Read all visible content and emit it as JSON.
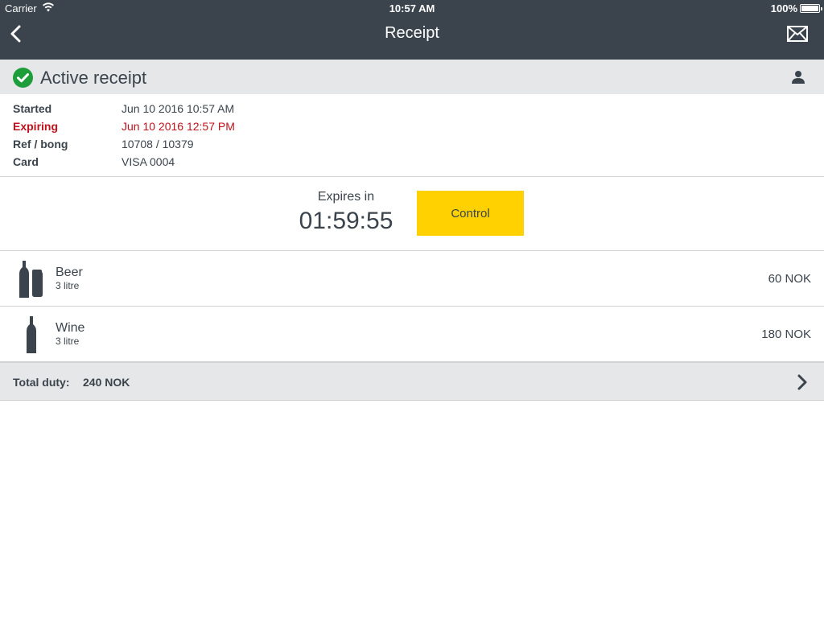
{
  "status_bar": {
    "carrier": "Carrier",
    "time": "10:57 AM",
    "battery": "100%"
  },
  "navbar": {
    "title": "Receipt",
    "back_icon": "chevron-left-icon",
    "mail_icon": "mail-icon"
  },
  "section": {
    "status_label": "Active receipt",
    "status_icon": "check-circle-icon",
    "user_icon": "user-icon"
  },
  "details": [
    {
      "key": "Started",
      "value": "Jun 10 2016 10:57 AM"
    },
    {
      "key": "Expiring",
      "value": "Jun 10 2016 12:57 PM"
    },
    {
      "key": "Ref / bong",
      "value": "10708 / 10379"
    },
    {
      "key": "Card",
      "value": "VISA 0004"
    }
  ],
  "timer": {
    "label": "Expires in",
    "value": "01:59:55",
    "control_label": "Control"
  },
  "items": [
    {
      "name": "Beer",
      "qty": "3 litre",
      "price": "60 NOK",
      "icon": "beer-bottle-can-icon"
    },
    {
      "name": "Wine",
      "qty": "3 litre",
      "price": "180 NOK",
      "icon": "wine-bottle-icon"
    }
  ],
  "total": {
    "label": "Total duty:",
    "value": "240 NOK"
  },
  "colors": {
    "header_bg": "#3b444d",
    "accent_yellow": "#ffd100",
    "status_green": "#1e9e3a",
    "expiring_red": "#c0121b",
    "section_bg": "#e6e7e8"
  }
}
